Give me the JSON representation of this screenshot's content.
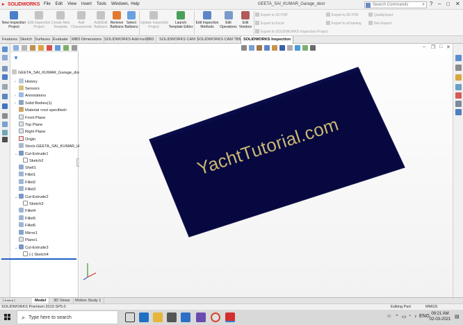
{
  "colors": {
    "part_fill": "#07083f",
    "part_outline": "#121448",
    "watermark": "#c9b772",
    "active_tab": "#ffffff",
    "accent": "#1e5ec8"
  },
  "titlebar": {
    "app_name": "SOLIDWORKS",
    "menu": [
      "File",
      "Edit",
      "View",
      "Insert",
      "Tools",
      "Window",
      "Help"
    ],
    "document_title": "GEETA_SAI_KUMAR_Garage_door",
    "search_placeholder": "Search Commands",
    "window_controls": [
      "?",
      "–",
      "□",
      "✕"
    ]
  },
  "commands": {
    "new_inspection": [
      "New Inspection",
      "Project"
    ],
    "edit_inspection": [
      "Edit Inspection",
      "Project"
    ],
    "create_template": [
      "Create New",
      "Template"
    ],
    "add_characteristic": [
      "Add",
      "Characteristic"
    ],
    "add_edit_balloons": [
      "Add/Edit",
      "Balloons"
    ],
    "remove_balloons": [
      "Remove",
      "Balloons"
    ],
    "select_balloons": [
      "Select",
      "Balloons"
    ],
    "update_project": [
      "Update Inspection",
      "Project"
    ],
    "launch_template_editor": [
      "Launch",
      "Template Editor"
    ],
    "edit_methods": [
      "Edit Inspection",
      "Methods"
    ],
    "edit_operations": [
      "Edit",
      "Operations"
    ],
    "edit_vendors": [
      "Edit",
      "Vendors"
    ],
    "export_2d_pdf": "Export to 2D PDF",
    "export_excel": "Export to Excel",
    "export_project": "Export to SOLIDWORKS Inspection Project",
    "export_3d_pdf": "Export to 3D PDF",
    "export_edrawing": "Export to eDrawing",
    "qualityxpert": "QualityXpert",
    "net_inspect": "Net-Inspect"
  },
  "tabs": [
    "Features",
    "Sketch",
    "Surfaces",
    "Evaluate",
    "MBD Dimensions",
    "SOLIDWORKS Add-Ins",
    "MBD",
    "SOLIDWORKS CAM",
    "SOLIDWORKS CAM TBM",
    "SOLIDWORKS Inspection"
  ],
  "tree": {
    "root": "GEETA_SAI_KUMAR_Garage_door",
    "items": [
      "History",
      "Sensors",
      "Annotations",
      "Solid Bodies(1)",
      "Material <not specified>",
      "Front Plane",
      "Top Plane",
      "Right Plane",
      "Origin",
      "Stock-GEETA_SAI_KUMAR_HULL1",
      "Cut-Extrude1",
      "Sketch2",
      "Shell1",
      "Fillet1",
      "Fillet2",
      "Fillet3",
      "Cut-Extrude2",
      "Sketch3",
      "Fillet4",
      "Fillet5",
      "Fillet6",
      "Mirror1",
      "Plane1",
      "Cut-Extrude3",
      "(-) Sketch4"
    ]
  },
  "viewport": {
    "watermark_text": "YachtTutorial.com"
  },
  "bottom_tabs": [
    "Model",
    "3D Views",
    "Motion Study 1"
  ],
  "statusbar": {
    "version": "SOLIDWORKS Premium 2019 SP5.0",
    "mode": "Editing Part",
    "units": "MMGS"
  },
  "taskbar": {
    "search_text": "Type here to search",
    "language": "ENG",
    "time": "09:21 AM",
    "date": "02-03-2021"
  }
}
